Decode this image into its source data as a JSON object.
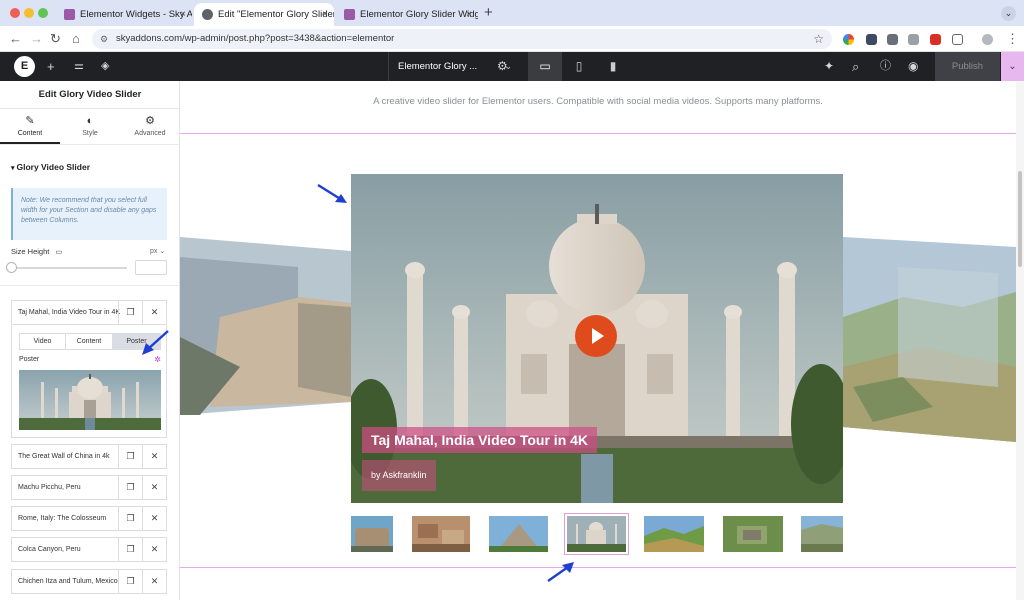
{
  "browser": {
    "tabs": [
      {
        "title": "Elementor Widgets - Sky Addons",
        "active": false,
        "favicon_color": "#9b5aa8"
      },
      {
        "title": "Edit \"Elementor Glory Slider V",
        "active": true,
        "favicon_color": "#5f6368"
      },
      {
        "title": "Elementor Glory Slider Widget",
        "active": false,
        "favicon_color": "#9b5aa8"
      }
    ],
    "tab_close_glyph": "×",
    "new_tab_glyph": "+",
    "url": "skyaddons.com/wp-admin/post.php?post=3438&action=elementor"
  },
  "elementor_bar": {
    "page_title": "Elementor Glory ...",
    "publish_label": "Publish"
  },
  "panel": {
    "title": "Edit Glory Video Slider",
    "tabs": [
      {
        "label": "Content",
        "icon": "pencil-icon",
        "active": true
      },
      {
        "label": "Style",
        "icon": "contrast-icon",
        "active": false
      },
      {
        "label": "Advanced",
        "icon": "gear-icon",
        "active": false
      }
    ],
    "section_title": "Glory Video Slider",
    "note": "Note: We recommend that you select full width for your Section and disable any gaps between Columns.",
    "size_height_label": "Size Height",
    "size_unit": "px",
    "items": [
      "Taj Mahal, India Video Tour in 4K",
      "The Great Wall of China in 4k",
      "Machu Picchu, Peru",
      "Rome, Italy: The Colosseum",
      "Colca Canyon, Peru",
      "Chichen Itza and Tulum, Mexico"
    ],
    "item_subtabs": [
      "Video",
      "Content",
      "Poster"
    ],
    "active_subtab": "Poster",
    "poster_label": "Poster"
  },
  "canvas": {
    "description": "A creative video slider for Elementor users. Compatible with social media videos. Supports many platforms.",
    "video_title": "Taj Mahal, India Video Tour in 4K",
    "video_author": "by Askfranklin",
    "thumbnail_count": 7,
    "active_thumbnail": 4
  },
  "colors": {
    "accent_pink": "#e6a7ee",
    "play_button": "#e04b1d",
    "caption_overlay": "#ce4c84",
    "annotation_arrow": "#1f3fd1"
  }
}
